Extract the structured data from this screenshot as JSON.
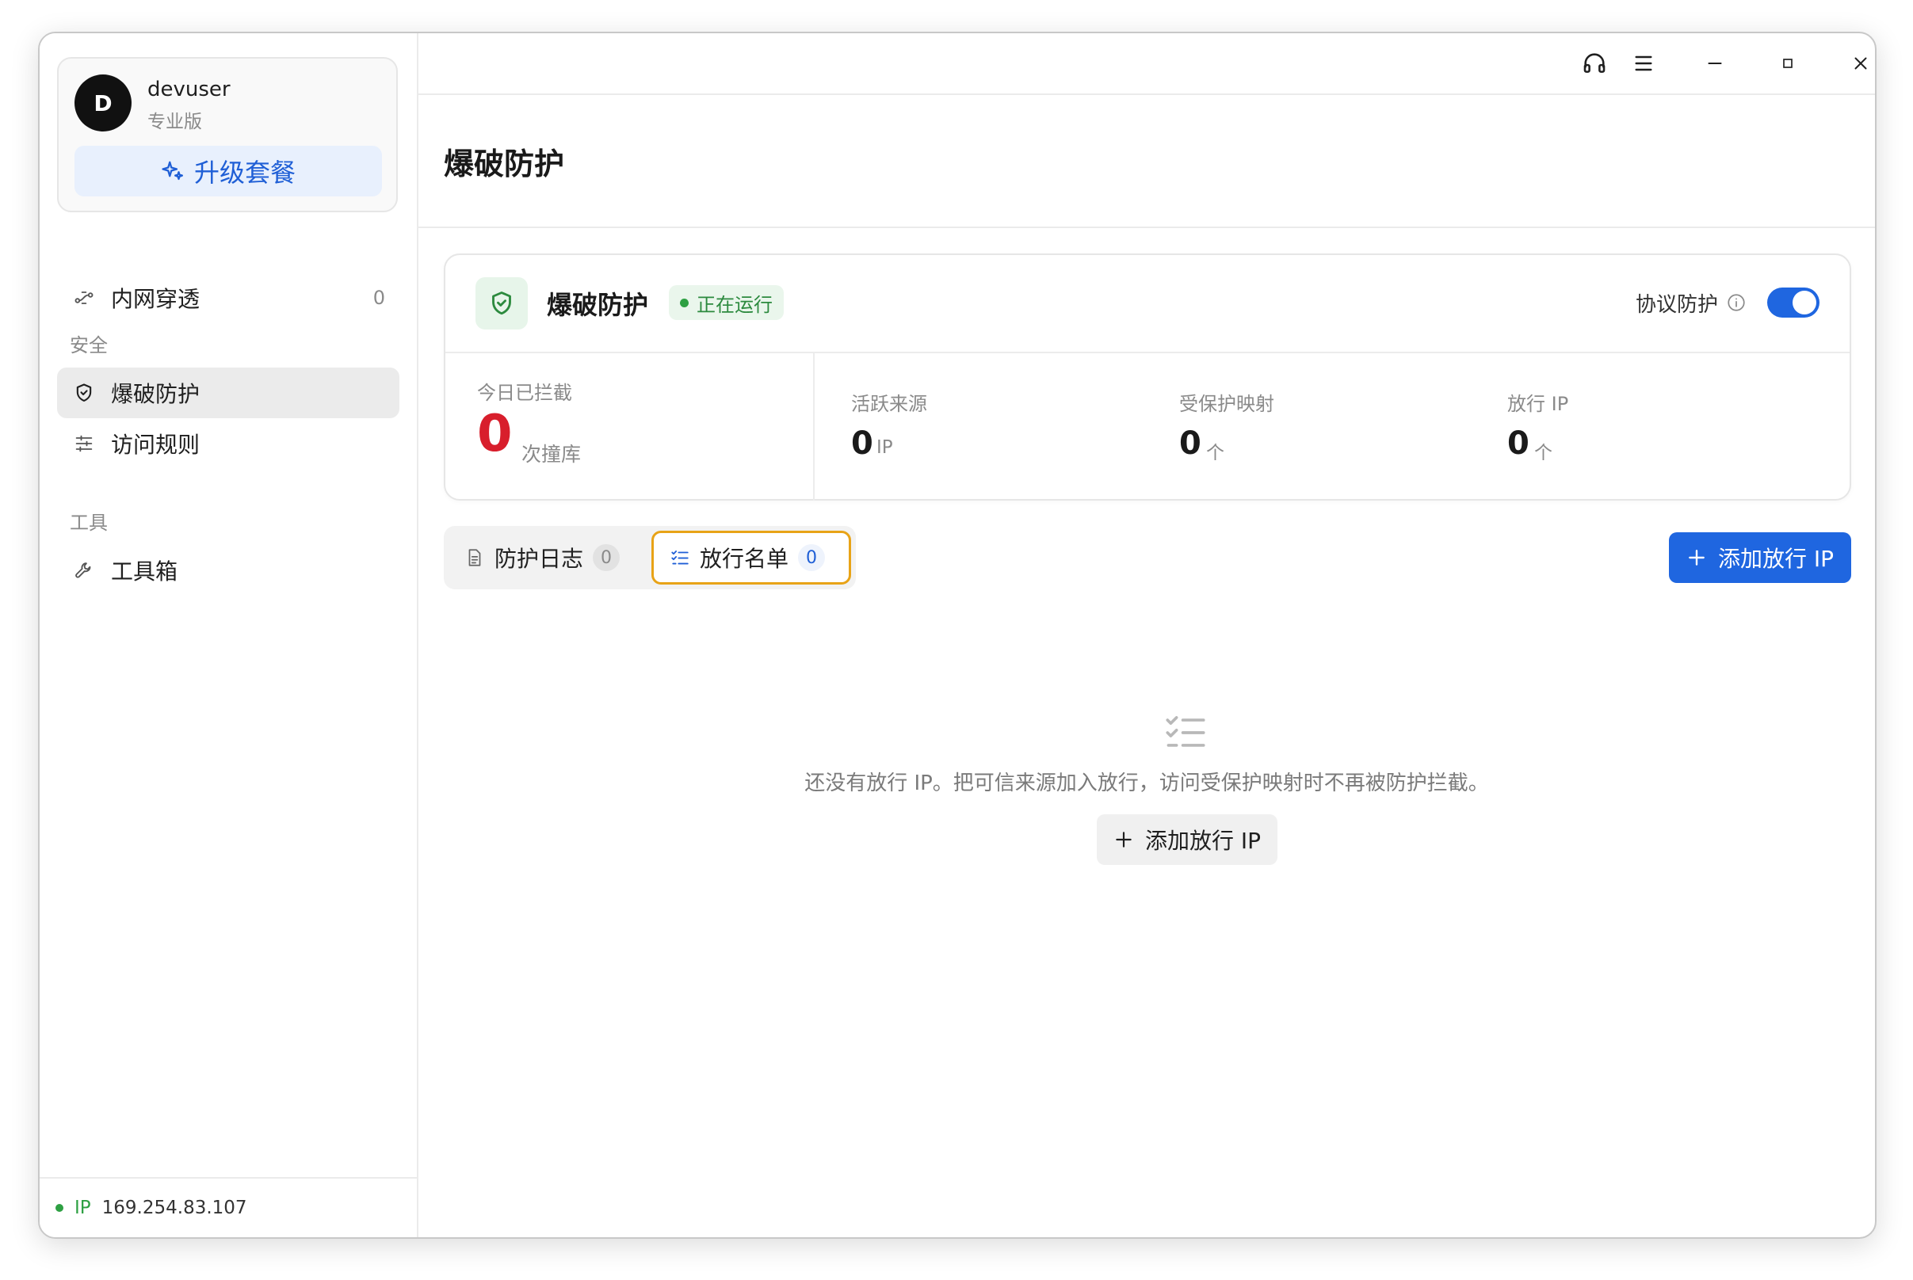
{
  "user": {
    "avatar_letter": "D",
    "name": "devuser",
    "plan": "专业版",
    "upgrade_label": "升级套餐"
  },
  "sidebar": {
    "items": [
      {
        "label": "内网穿透",
        "count": "0",
        "icon": "tunnel-icon"
      },
      {
        "label": "爆破防护",
        "icon": "shield-icon",
        "active": true
      },
      {
        "label": "访问规则",
        "icon": "sliders-icon"
      },
      {
        "label": "工具箱",
        "icon": "wrench-icon"
      }
    ],
    "sections": {
      "security": "安全",
      "tools": "工具"
    },
    "footer": {
      "ip_tag": "IP",
      "ip_value": "169.254.83.107"
    }
  },
  "titlebar": {
    "icons": [
      "headset-icon",
      "menu-icon",
      "minimize-icon",
      "maximize-icon",
      "close-icon"
    ]
  },
  "page": {
    "title": "爆破防护"
  },
  "status_card": {
    "title": "爆破防护",
    "status": "正在运行",
    "protocol_label": "协议防护",
    "protocol_enabled": true,
    "today_blocked": {
      "label": "今日已拦截",
      "value": "0",
      "unit": "次撞库"
    },
    "stats": [
      {
        "label": "活跃来源",
        "value": "0",
        "unit": "IP"
      },
      {
        "label": "受保护映射",
        "value": "0",
        "unit": "个"
      },
      {
        "label": "放行 IP",
        "value": "0",
        "unit": "个"
      }
    ]
  },
  "tabs": [
    {
      "label": "防护日志",
      "count": "0",
      "icon": "document-icon"
    },
    {
      "label": "放行名单",
      "count": "0",
      "icon": "checklist-icon",
      "active": true
    }
  ],
  "actions": {
    "add_allow_ip": "添加放行 IP"
  },
  "empty_state": {
    "message": "还没有放行 IP。把可信来源加入放行，访问受保护映射时不再被防护拦截。",
    "button_label": "添加放行 IP"
  },
  "colors": {
    "accent": "#1f66e0",
    "success": "#2ea043",
    "danger": "#d81e2c",
    "focus": "#e8a317"
  }
}
